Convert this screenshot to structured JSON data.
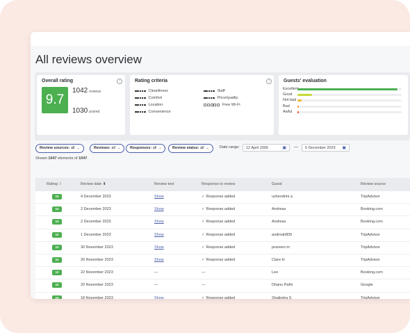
{
  "page_title": "All reviews overview",
  "overall": {
    "title": "Overall rating",
    "score": "9.7",
    "reviews_count": "1042",
    "reviews_label": "reviews",
    "posted_count": "1030",
    "posted_label": "posted",
    "score_color": "#4caf50"
  },
  "criteria": {
    "title": "Rating criteria",
    "items": [
      {
        "label": "Cleanliness",
        "filled": 5
      },
      {
        "label": "Comfort",
        "filled": 5
      },
      {
        "label": "Location",
        "filled": 5
      },
      {
        "label": "Convenience",
        "filled": 5
      },
      {
        "label": "Staff",
        "filled": 5
      },
      {
        "label": "Price/quality",
        "filled": 5
      },
      {
        "label": "Free Wi-Fi",
        "filled": 0
      }
    ]
  },
  "guests": {
    "title": "Guests' evaluation",
    "rows": [
      {
        "label": "Excellent",
        "fraction": 0.96,
        "color": "#4caf50"
      },
      {
        "label": "Good",
        "fraction": 0.14,
        "color": "#c6d93b"
      },
      {
        "label": "Not bad",
        "fraction": 0.04,
        "color": "#f2b531"
      },
      {
        "label": "Bad",
        "fraction": 0.015,
        "color": "#f29b31"
      },
      {
        "label": "Awful",
        "fraction": 0.015,
        "color": "#e84c3d"
      }
    ]
  },
  "filters": {
    "review_sources": {
      "label": "Review sources:",
      "value": "all"
    },
    "reviews": {
      "label": "Reviews:",
      "value": "all"
    },
    "responses": {
      "label": "Responses:",
      "value": "all"
    },
    "review_status": {
      "label": "Review status:",
      "value": "all"
    },
    "date_range_label": "Date range:",
    "date_from": "12 April 2006",
    "date_to": "5 December 2023"
  },
  "shown": {
    "prefix": "Shown",
    "count": "1047",
    "middle": "elements of",
    "total": "1047",
    "suffix": "."
  },
  "table": {
    "headers": {
      "rating": "Rating",
      "date": "Review date",
      "text": "Review text",
      "response": "Response to review",
      "guest": "Guest",
      "source": "Review source"
    },
    "rows": [
      {
        "rating": "10",
        "date": "4 December 2023",
        "text": "Show",
        "response": "Response added",
        "responded": true,
        "guest": "ushendrini a",
        "source": "TripAdvisor"
      },
      {
        "rating": "10",
        "date": "2 December 2023",
        "text": "Show",
        "response": "Response added",
        "responded": true,
        "guest": "Andreas",
        "source": "Booking.com"
      },
      {
        "rating": "10",
        "date": "2 December 2023",
        "text": "Show",
        "response": "Response added",
        "responded": true,
        "guest": "Andreas",
        "source": "Booking.com"
      },
      {
        "rating": "10",
        "date": "1 December 2023",
        "text": "Show",
        "response": "Response added",
        "responded": true,
        "guest": "andreah805",
        "source": "TripAdvisor"
      },
      {
        "rating": "10",
        "date": "30 November 2023",
        "text": "Show",
        "response": "Response added",
        "responded": true,
        "guest": "praveen m",
        "source": "TripAdvisor"
      },
      {
        "rating": "10",
        "date": "26 November 2023",
        "text": "Show",
        "response": "Response added",
        "responded": true,
        "guest": "Clare H",
        "source": "TripAdvisor"
      },
      {
        "rating": "10",
        "date": "22 November 2023",
        "text": "—",
        "response": "—",
        "responded": false,
        "guest": "Lee",
        "source": "Booking.com"
      },
      {
        "rating": "10",
        "date": "20 November 2023",
        "text": "—",
        "response": "—",
        "responded": false,
        "guest": "Dhanu Pathi",
        "source": "Google"
      },
      {
        "rating": "10",
        "date": "18 November 2023",
        "text": "Show",
        "response": "Response added",
        "responded": true,
        "guest": "Shalindra S",
        "source": "TripAdvisor"
      }
    ]
  },
  "icons": {
    "info": "info-icon",
    "calendar": "calendar-icon",
    "chevron": "chevron-down-icon",
    "sort": "sort-icon",
    "check": "check-icon"
  },
  "colors": {
    "accent": "#4a5da8",
    "positive": "#4caf50",
    "background": "#fbe9e4"
  }
}
